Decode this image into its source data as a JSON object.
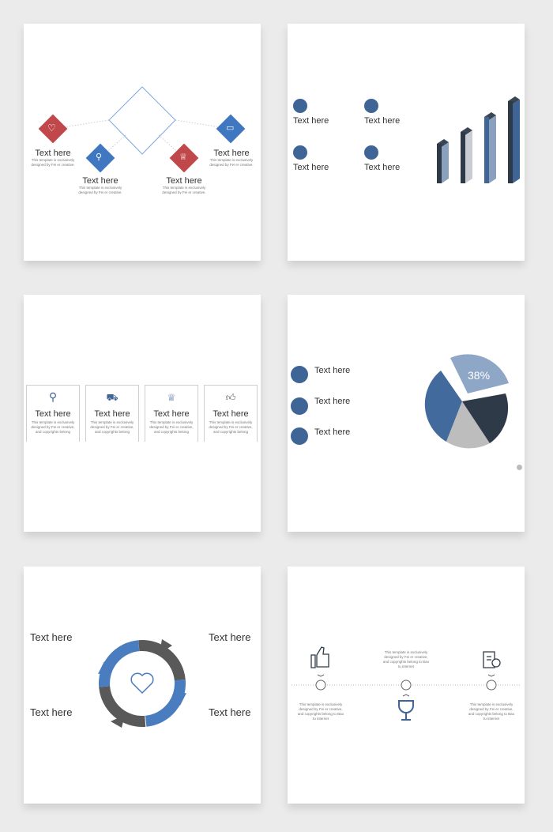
{
  "colors": {
    "red": "#c0474a",
    "blue": "#3f77c0",
    "navy": "#3f6597",
    "dark": "#2f3a48",
    "gray": "#bdbdbd",
    "background": "#ebebeb"
  },
  "slide1": {
    "items": [
      {
        "icon": "heart-icon",
        "title": "Text here",
        "desc": "This template is exclusively\ndesigned by Fei er creative."
      },
      {
        "icon": "search-icon",
        "title": "Text here",
        "desc": "This template is exclusively\ndesigned by Fei er creative."
      },
      {
        "icon": "trophy-icon",
        "title": "Text here",
        "desc": "This template is exclusively\ndesigned by Fei er creative."
      },
      {
        "icon": "chat-icon",
        "title": "Text here",
        "desc": "This template is exclusively\ndesigned by Fei er creative."
      }
    ]
  },
  "slide2": {
    "items": [
      {
        "icon": "lock-icon",
        "title": "Text here"
      },
      {
        "icon": "trophy-icon",
        "title": "Text here"
      },
      {
        "icon": "location-icon",
        "title": "Text here"
      },
      {
        "icon": "document-icon",
        "title": "Text here"
      }
    ]
  },
  "slide3": {
    "items": [
      {
        "icon": "search-icon",
        "title": "Text here",
        "desc": "This template is exclusively\ndesigned by Fei er creative,\nand copyrights belong"
      },
      {
        "icon": "cart-icon",
        "title": "Text here",
        "desc": "This template is exclusively\ndesigned by Fei er creative,\nand copyrights belong"
      },
      {
        "icon": "trophy-icon",
        "title": "Text here",
        "desc": "This template is exclusively\ndesigned by Fei er creative,\nand copyrights belong"
      },
      {
        "icon": "thumbs-up-icon",
        "title": "Text here",
        "desc": "This template is exclusively\ndesigned by Fei er creative,\nand copyrights belong"
      }
    ]
  },
  "slide4": {
    "items": [
      {
        "icon": "chat-icon",
        "title": "Text here"
      },
      {
        "icon": "monitor-icon",
        "title": "Text here"
      },
      {
        "icon": "zoom-out-icon",
        "title": "Text here"
      }
    ],
    "pie_label": "38%"
  },
  "slide5": {
    "labels": [
      "Text here",
      "Text here",
      "Text here",
      "Text here"
    ]
  },
  "slide6": {
    "descs": [
      "This template is exclusively\ndesigned by Fei er creative,\nand copyrights belong to Bao\ntu internet",
      "This template is exclusively\ndesigned by Fei er creative,\nand copyrights belong to Bao\ntu internet",
      "This template is exclusively\ndesigned by Fei er creative,\nand copyrights belong to Bao\ntu internet"
    ]
  }
}
